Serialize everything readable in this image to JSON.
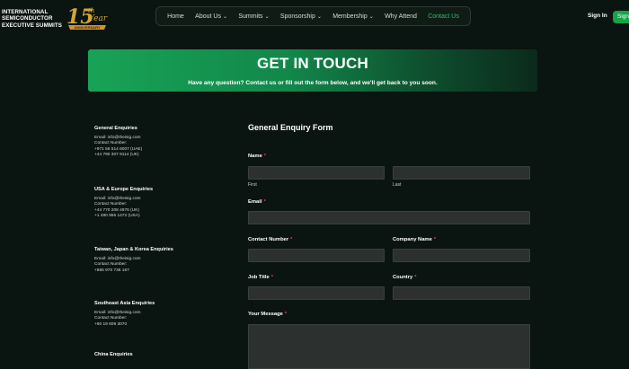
{
  "header": {
    "logo_lines": [
      "INTERNATIONAL",
      "SEMICONDUCTOR",
      "EXECUTIVE SUMMITS"
    ],
    "badge": {
      "number": "15",
      "suffix": "th",
      "word": "Year",
      "ribbon": "ANNIVERSARY"
    },
    "nav": [
      {
        "label": "Home",
        "has_dropdown": false,
        "active": false
      },
      {
        "label": "About Us",
        "has_dropdown": true,
        "active": false
      },
      {
        "label": "Summits",
        "has_dropdown": true,
        "active": false
      },
      {
        "label": "Sponsorship",
        "has_dropdown": true,
        "active": false
      },
      {
        "label": "Membership",
        "has_dropdown": true,
        "active": false
      },
      {
        "label": "Why Attend",
        "has_dropdown": false,
        "active": false
      },
      {
        "label": "Contact Us",
        "has_dropdown": false,
        "active": true
      }
    ],
    "signin_label": "Sign In",
    "signup_label": "Sign"
  },
  "banner": {
    "title": "GET IN TOUCH",
    "subtitle": "Have any question? Contact us or fill out the form below, and we'll get back to you soon."
  },
  "contacts": [
    {
      "heading": "General Enquiries",
      "lines": [
        "Email: info@theisig.com",
        "Contact Number:",
        "+971 56 514 6007 (UAE)",
        "+44 790 307 9114 (UK)"
      ]
    },
    {
      "heading": "USA & Europe Enquiries",
      "lines": [
        "Email: info@theisig.com",
        "Contact Number:",
        "+44 770 208 4976 (UK)",
        "+1 480 956 1472 (USA)"
      ]
    },
    {
      "heading": "Taiwan, Japan & Korea Enquiries",
      "lines": [
        "Email: info@theisig.com",
        "Contact Number:",
        "+886 970 736 167"
      ]
    },
    {
      "heading": "Southeast Asia Enquiries",
      "lines": [
        "Email: info@theisig.com",
        "Contact Number:",
        "+60 19 609 3070"
      ]
    },
    {
      "heading": "China Enquiries",
      "lines": []
    }
  ],
  "form": {
    "title": "General Enquiry Form",
    "name_label": "Name",
    "first_label": "First",
    "last_label": "Last",
    "email_label": "Email",
    "contact_number_label": "Contact Number",
    "company_name_label": "Company Name",
    "job_title_label": "Job Title",
    "country_label": "Country",
    "message_label": "Your Message",
    "required_mark": "*"
  },
  "colors": {
    "background": "#0a1410",
    "accent": "#22c55e",
    "banner_start": "#18a356",
    "required": "#ef4444",
    "field_bg": "#2c3130"
  }
}
